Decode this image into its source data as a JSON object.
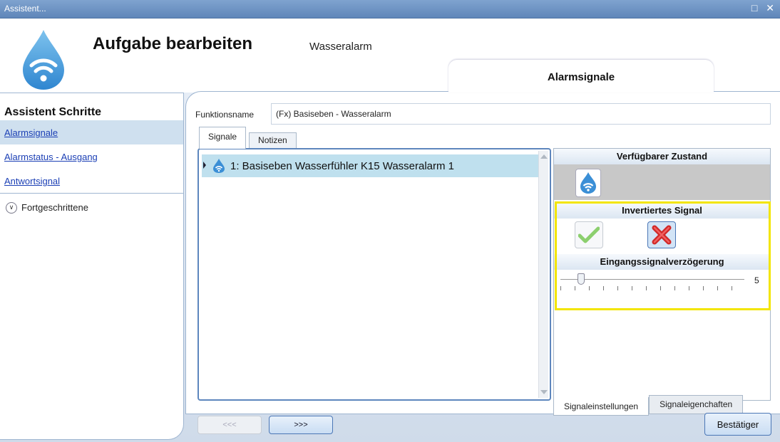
{
  "window": {
    "title": "Assistent..."
  },
  "header": {
    "title": "Aufgabe bearbeiten",
    "subtitle": "Wasseralarm",
    "app_icon": "water-drop-icon"
  },
  "step_tab": {
    "label": "Alarmsignale"
  },
  "sidebar": {
    "title": "Assistent Schritte",
    "items": [
      {
        "label": "Alarmsignale",
        "active": true
      },
      {
        "label": "Alarmstatus - Ausgang",
        "active": false
      },
      {
        "label": "Antwortsignal",
        "active": false
      }
    ],
    "advanced_label": "Fortgeschrittene"
  },
  "form": {
    "function_name_label": "Funktionsname",
    "function_name_value": "(Fx) Basiseben - Wasseralarm"
  },
  "tabs": [
    {
      "label": "Signale",
      "active": true
    },
    {
      "label": "Notizen",
      "active": false
    }
  ],
  "signals": [
    {
      "label": "1: Basiseben Wasserfühler K15 Wasseralarm 1",
      "icon": "water-drop-icon"
    }
  ],
  "properties": {
    "available_state_title": "Verfügbarer Zustand",
    "inverted_signal_title": "Invertiertes Signal",
    "inverted_signal_selected": "no",
    "input_delay_title": "Eingangssignalverzögerung",
    "input_delay_value": "5",
    "bottom_tabs": [
      {
        "label": "Signaleinstellungen",
        "active": true
      },
      {
        "label": "Signaleigenchaften",
        "active": false
      }
    ]
  },
  "buttons": {
    "prev": "<<<",
    "next": ">>>",
    "confirm": "Bestätiger"
  },
  "colors": {
    "highlight": "#f3e500",
    "titlebar": "#6a8fc2",
    "selected_row": "#bfe0ee",
    "link": "#1b3fb5"
  }
}
